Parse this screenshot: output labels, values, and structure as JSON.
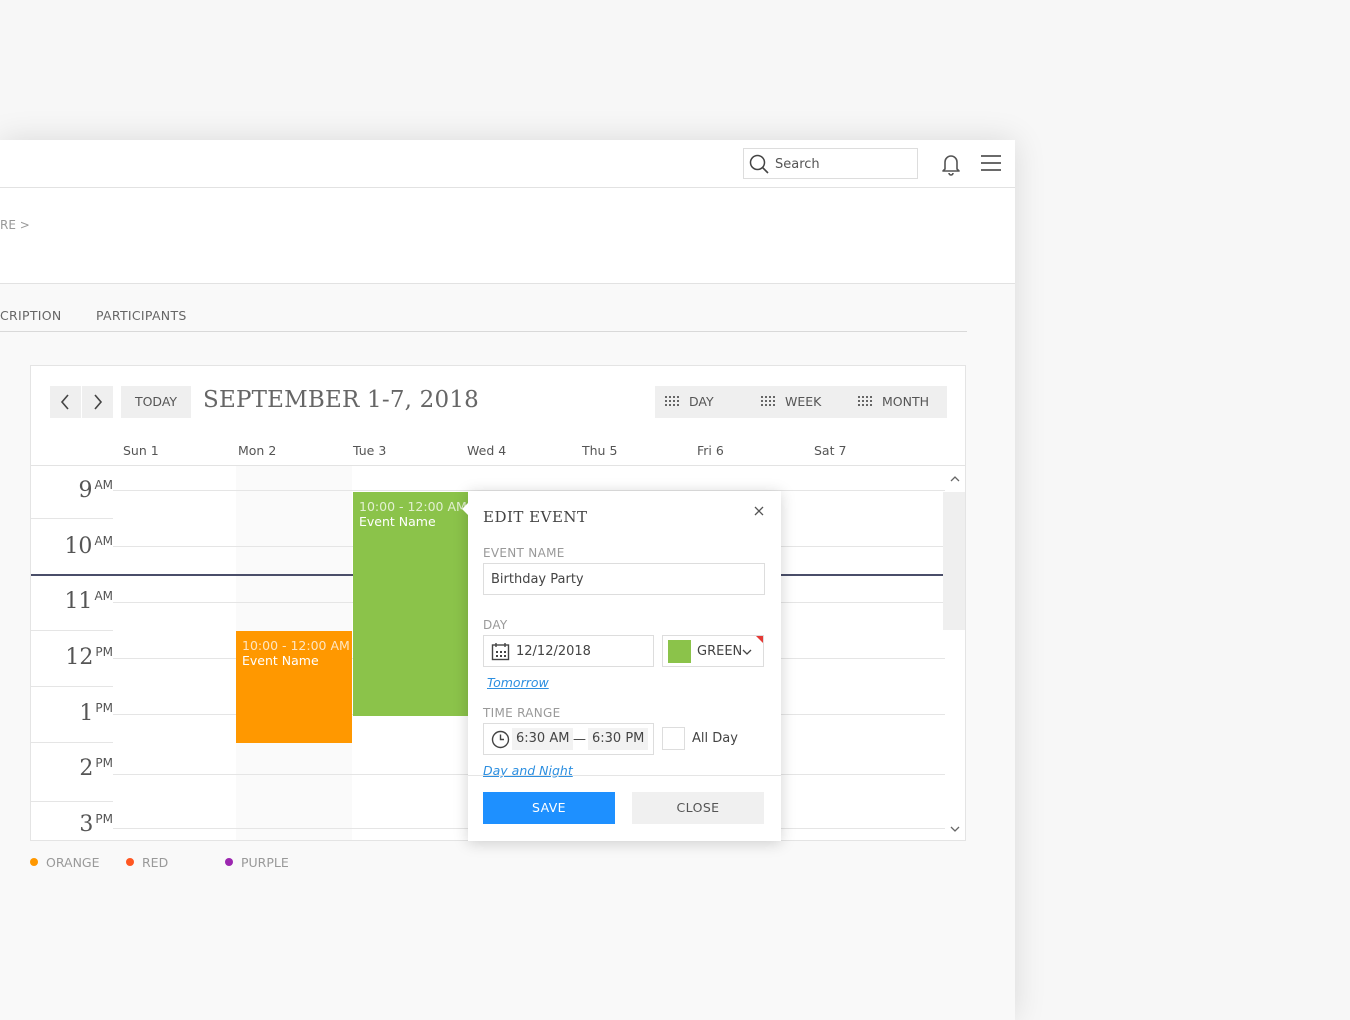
{
  "topbar": {
    "search_placeholder": "Search"
  },
  "breadcrumb": "RE >",
  "tabs": [
    {
      "label": "CRIPTION"
    },
    {
      "label": "PARTICIPANTS"
    }
  ],
  "calendar": {
    "today_label": "TODAY",
    "range_title": "SEPTEMBER 1-7, 2018",
    "views": [
      {
        "label": "DAY"
      },
      {
        "label": "WEEK"
      },
      {
        "label": "MONTH"
      }
    ],
    "days": [
      "Sun 1",
      "Mon 2",
      "Tue 3",
      "Wed 4",
      "Thu 5",
      "Fri 6",
      "Sat 7"
    ],
    "hours": [
      {
        "num": "9",
        "suffix": "AM"
      },
      {
        "num": "10",
        "suffix": "AM"
      },
      {
        "num": "11",
        "suffix": "AM"
      },
      {
        "num": "12",
        "suffix": "PM"
      },
      {
        "num": "1",
        "suffix": "PM"
      },
      {
        "num": "2",
        "suffix": "PM"
      },
      {
        "num": "3",
        "suffix": "PM"
      }
    ],
    "events": [
      {
        "time": "10:00 - 12:00 AM",
        "name": "Event Name",
        "color": "#ff9800"
      },
      {
        "time": "10:00 - 12:00 AM",
        "name": "Event Name",
        "color": "#8bc34a"
      }
    ]
  },
  "legend": [
    {
      "label": "ORANGE",
      "color": "#ff9800"
    },
    {
      "label": "RED",
      "color": "#ff5722"
    },
    {
      "label": "PURPLE",
      "color": "#9c27b0"
    }
  ],
  "edit_event": {
    "title": "EDIT EVENT",
    "event_name_label": "EVENT NAME",
    "event_name_value": "Birthday Party",
    "day_label": "DAY",
    "day_value": "12/12/2018",
    "color_value": "GREEN",
    "color_swatch": "#8bc34a",
    "tomorrow_link": "Tomorrow",
    "time_range_label": "TIME RANGE",
    "time_start": "6:30 AM",
    "time_separator": "—",
    "time_end": "6:30 PM",
    "all_day_label": "All Day",
    "day_night_link": "Day and Night",
    "save_label": "SAVE",
    "close_label": "CLOSE"
  }
}
